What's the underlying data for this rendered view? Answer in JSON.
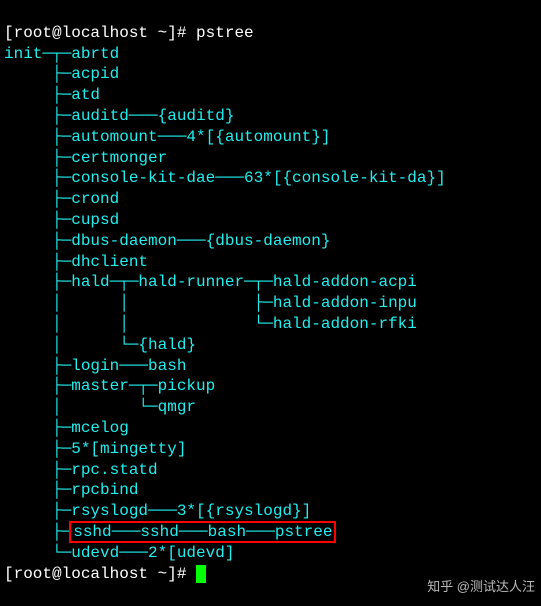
{
  "prompt": {
    "user_host": "[root@localhost ~]#",
    "command": "pstree"
  },
  "tree": {
    "l01": "init─┬─abrtd",
    "l02": "     ├─acpid",
    "l03": "     ├─atd",
    "l04": "     ├─auditd───{auditd}",
    "l05": "     ├─automount───4*[{automount}]",
    "l06": "     ├─certmonger",
    "l07": "     ├─console-kit-dae───63*[{console-kit-da}]",
    "l08": "     ├─crond",
    "l09": "     ├─cupsd",
    "l10": "     ├─dbus-daemon───{dbus-daemon}",
    "l11": "     ├─dhclient",
    "l12": "     ├─hald─┬─hald-runner─┬─hald-addon-acpi",
    "l13": "     │      │             ├─hald-addon-inpu",
    "l14": "     │      │             └─hald-addon-rfki",
    "l15": "     │      └─{hald}",
    "l16": "     ├─login───bash",
    "l17": "     ├─master─┬─pickup",
    "l18": "     │        └─qmgr",
    "l19": "     ├─mcelog",
    "l20": "     ├─5*[mingetty]",
    "l21": "     ├─rpc.statd",
    "l22": "     ├─rpcbind",
    "l23": "     ├─rsyslogd───3*[{rsyslogd}]",
    "l24a": "     ├─",
    "l24b": "sshd───sshd───bash───pstree",
    "l25": "     └─udevd───2*[udevd]"
  },
  "watermark": "知乎 @测试达人汪"
}
